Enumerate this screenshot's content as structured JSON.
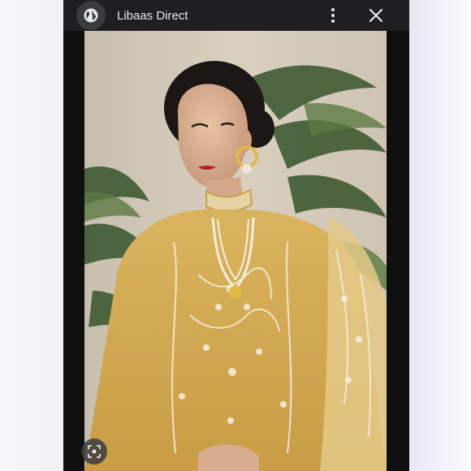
{
  "header": {
    "site_name": "Libaas Direct",
    "site_icon": "globe-icon",
    "menu_icon": "more-vert-icon",
    "close_icon": "close-icon"
  },
  "image": {
    "subject": "woman-in-embroidered-gold-outfit"
  },
  "lens": {
    "icon": "lens-search-icon"
  },
  "colors": {
    "topbar": "#1f1f21",
    "viewer_bg": "#0f0f10",
    "text": "#e8eaed",
    "outfit_gold": "#d4a954"
  }
}
